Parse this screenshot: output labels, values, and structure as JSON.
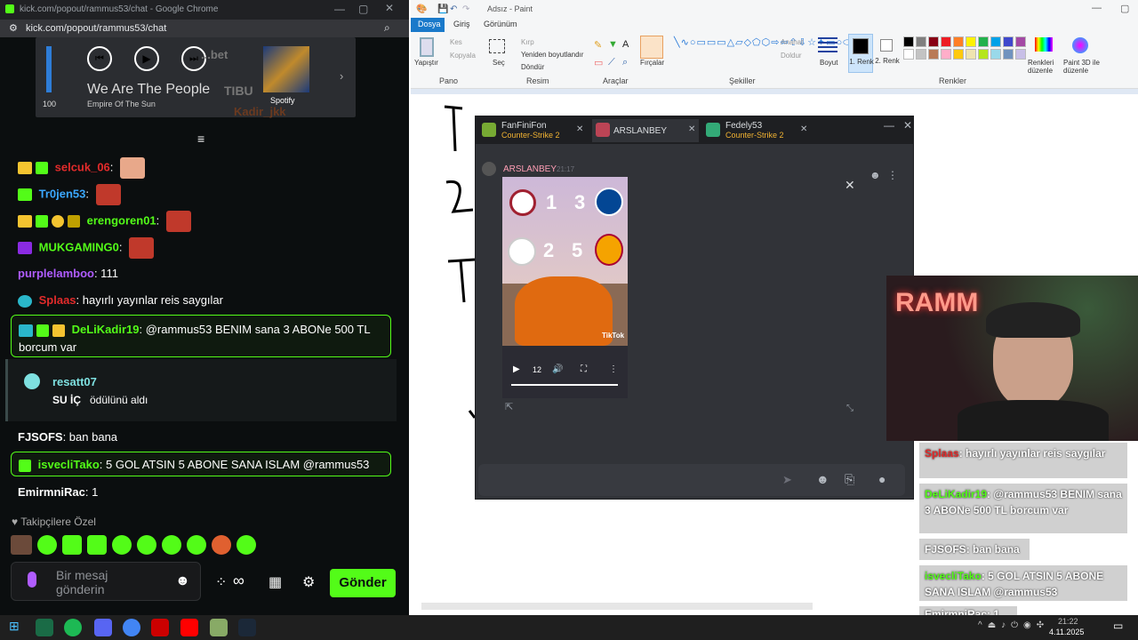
{
  "chrome": {
    "title": "kick.com/popout/rammus53/chat - Google Chrome",
    "url": "kick.com/popout/rammus53/chat"
  },
  "spotify": {
    "volume": "100",
    "song_title": "We Are The People",
    "artist": "Empire Of The Sun",
    "brand": "Spotify",
    "ghost_top": "...bet",
    "ghost_mid": "TIBU",
    "ghost_user": "Kadir_jkk"
  },
  "chat": {
    "messages": [
      {
        "user": "selcuk_06",
        "text": ":",
        "color": "#e22b2b"
      },
      {
        "user": "Tr0jen53",
        "text": ":",
        "color": "#3ba8ff"
      },
      {
        "user": "erengoren01",
        "text": ":",
        "color": "#53fc18"
      },
      {
        "user": "MUKGAMING0",
        "text": ":",
        "color": "#53fc18"
      },
      {
        "user": "purplelamboo",
        "text": ": 111",
        "color": "#b05cff"
      },
      {
        "user": "Splaas",
        "text": ": hayırlı yayınlar reis saygılar",
        "color": "#e22b2b"
      }
    ],
    "highlight1": {
      "user": "DeLiKadir19",
      "text": ": @rammus53 BENIM sana 3 ABONe 500 TL borcum var",
      "color": "#53fc18"
    },
    "reward": {
      "user": "resatt07",
      "text": "SU İÇ",
      "suffix": "ödülünü aldı"
    },
    "fjsofs": {
      "user": "FJSOFS",
      "text": ": ban bana",
      "color": "#ffffff"
    },
    "highlight2": {
      "user": "isvecliTako",
      "text": ": 5 GOL ATSIN 5 ABONE SANA ISLAM @rammus53",
      "color": "#53fc18"
    },
    "emirmni": {
      "user": "EmirmniRac",
      "text": ": 1",
      "color": "#ffffff"
    },
    "followers_label": "Takipçilere Özel",
    "input_placeholder": "Bir mesaj gönderin",
    "send_label": "Gönder"
  },
  "paint": {
    "title": "Adsız - Paint",
    "tabs": [
      "Dosya",
      "Giriş",
      "Görünüm"
    ],
    "groups": [
      "Pano",
      "Resim",
      "Araçlar",
      "Şekiller",
      "Renkler"
    ],
    "labels": {
      "paste": "Yapıştır",
      "cut": "Kes",
      "copy": "Kopyala",
      "select": "Seç",
      "crop": "Kırp",
      "resize": "Yeniden boyutlandır",
      "rotate": "Döndür",
      "brushes": "Fırçalar",
      "outline": "Anahat",
      "fill": "Doldur",
      "size": "Boyut",
      "color1": "1. Renk",
      "color2": "2. Renk",
      "edit_colors": "Renkleri düzenle",
      "paint3d": "Paint 3D ile düzenle"
    },
    "palette": [
      "#000000",
      "#7f7f7f",
      "#880015",
      "#ed1c24",
      "#ff7f27",
      "#fff200",
      "#22b14c",
      "#00a2e8",
      "#3f48cc",
      "#a349a4",
      "#ffffff",
      "#c3c3c3",
      "#b97a57",
      "#ffaec9",
      "#ffc90e",
      "#efe4b0",
      "#b5e61d",
      "#99d9ea",
      "#7092be",
      "#c8bfe7"
    ]
  },
  "discord": {
    "tabs": [
      {
        "name": "FanFiniFon",
        "sub": "Counter-Strike 2"
      },
      {
        "name": "ARSLANBEY",
        "sub": ""
      },
      {
        "name": "Fedely53",
        "sub": "Counter-Strike 2"
      }
    ],
    "author": "ARSLANBEY",
    "time": "21:17",
    "scores": [
      "1",
      "3",
      "2",
      "5"
    ],
    "video_time": "12",
    "tiktok": "TikTok"
  },
  "overlay_chat": [
    {
      "user": "Splaas",
      "text": ": hayırlı yayınlar reis saygılar"
    },
    {
      "user": "DeLiKadir19",
      "text": ": @rammus53 BENIM sana 3 ABONe 500 TL borcum var"
    },
    {
      "user": "FJSOFS",
      "text": ": ban bana"
    },
    {
      "user": "isvecliTako",
      "text": ": 5 GOL ATSIN 5 ABONE SANA ISLAM @rammus53"
    },
    {
      "user": "EmirmniRac",
      "text": ": 1"
    }
  ],
  "taskbar": {
    "time": "21:22",
    "date": "4.11.2025"
  }
}
